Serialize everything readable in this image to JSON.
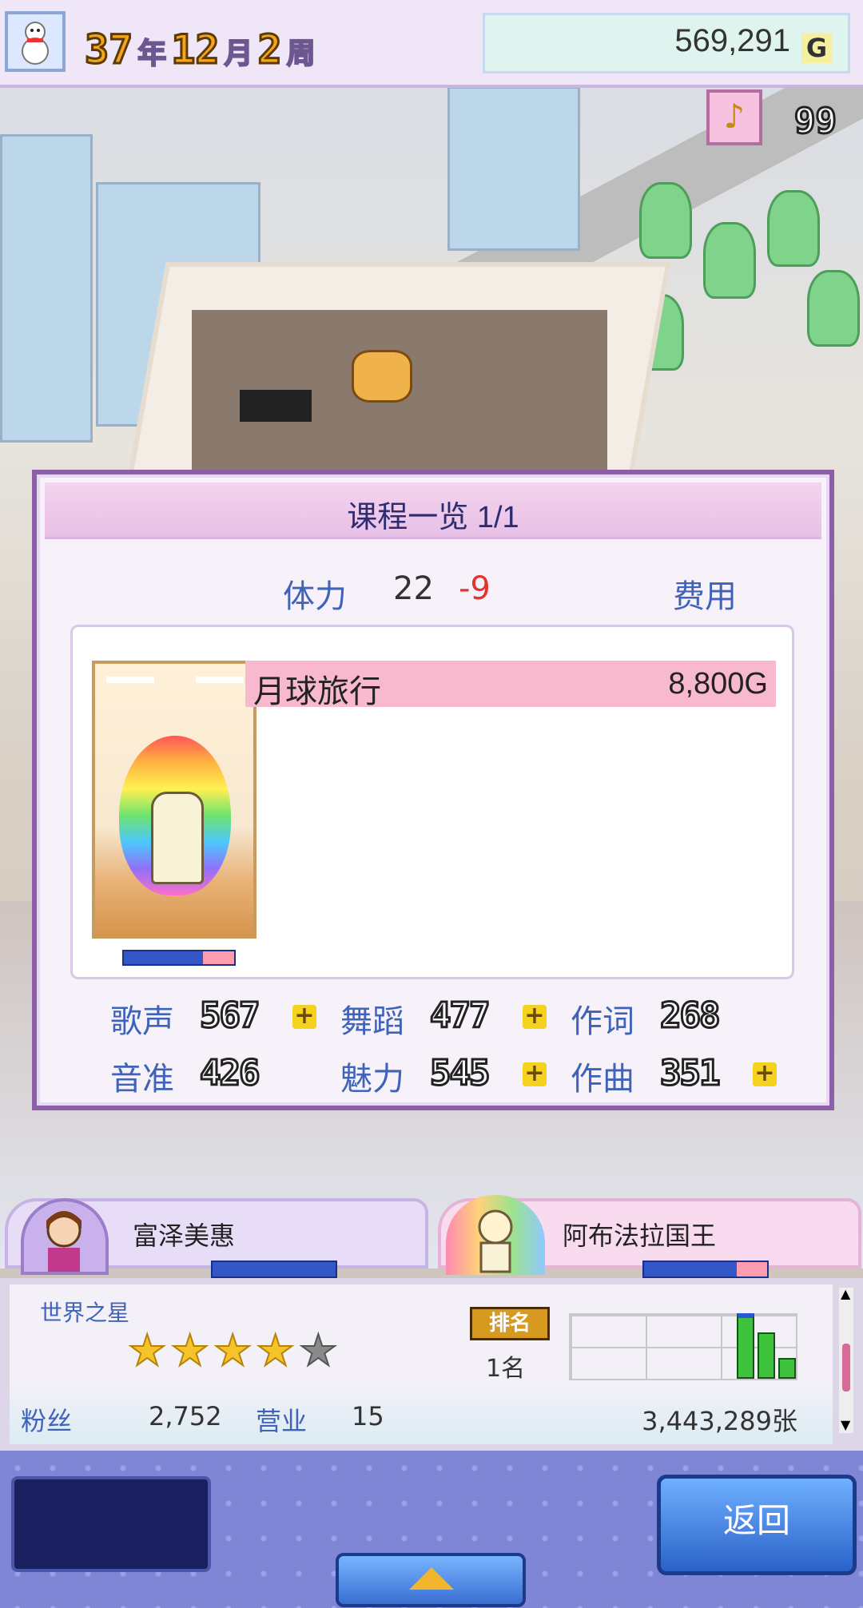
{
  "top_bar": {
    "year": "37",
    "year_unit": "年",
    "month": "12",
    "month_unit": "月",
    "week": "2",
    "week_unit": "周",
    "money": "569,291",
    "money_unit": "G",
    "award_count": "99"
  },
  "dialog": {
    "title": "课程一览 1/1",
    "stamina_label": "体力",
    "stamina_value": "22",
    "stamina_delta": "-9",
    "cost_label": "费用",
    "course": {
      "name": "月球旅行",
      "price": "8,800G"
    },
    "portrait_gauge": 0.28,
    "stats": [
      {
        "label": "歌声",
        "value": "567",
        "boost": true
      },
      {
        "label": "舞蹈",
        "value": "477",
        "boost": true
      },
      {
        "label": "作词",
        "value": "268",
        "boost": false
      },
      {
        "label": "音准",
        "value": "426",
        "boost": false
      },
      {
        "label": "魅力",
        "value": "545",
        "boost": true
      },
      {
        "label": "作曲",
        "value": "351",
        "boost": true
      }
    ],
    "plus_symbol": "+"
  },
  "tabs": [
    {
      "name": "富泽美惠",
      "gauge": 1.0
    },
    {
      "name": "阿布法拉国王",
      "gauge": 0.75
    }
  ],
  "info": {
    "title": "世界之星",
    "stars_filled": 4,
    "stars_total": 5,
    "rank_badge": "排名",
    "rank_value": "1名",
    "fans_label": "粉丝",
    "fans_value": "2,752",
    "business_label": "营业",
    "business_value": "15",
    "sales_value": "3,443,289张"
  },
  "buttons": {
    "back": "返回"
  },
  "colors": {
    "accent_blue": "#3f63b8",
    "delta_red": "#e0342c",
    "course_pink": "#f8b9cf"
  }
}
